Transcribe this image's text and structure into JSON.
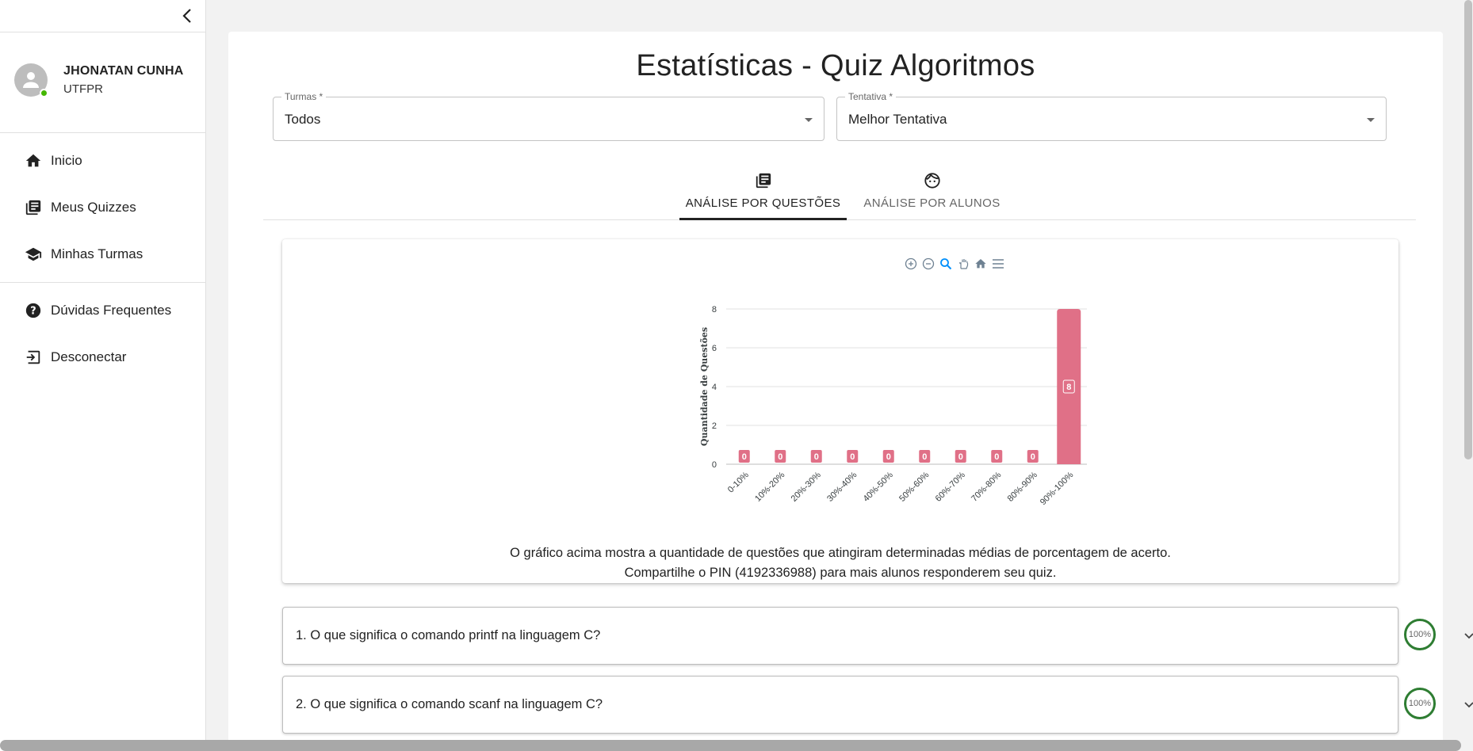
{
  "sidebar": {
    "user": {
      "name": "JHONATAN CUNHA",
      "org": "UTFPR",
      "status_color": "#44b700"
    },
    "nav": [
      {
        "label": "Inicio",
        "icon": "home-icon"
      },
      {
        "label": "Meus Quizzes",
        "icon": "library-books-icon"
      },
      {
        "label": "Minhas Turmas",
        "icon": "school-icon"
      }
    ],
    "nav_secondary": [
      {
        "label": "Dúvidas Frequentes",
        "icon": "help-icon"
      },
      {
        "label": "Desconectar",
        "icon": "logout-icon"
      }
    ]
  },
  "main": {
    "title": "Estatísticas - Quiz Algoritmos",
    "filters": {
      "turmas": {
        "label": "Turmas *",
        "value": "Todos"
      },
      "tentativa": {
        "label": "Tentativa *",
        "value": "Melhor Tentativa"
      }
    },
    "tabs": [
      {
        "label": "ANÁLISE POR QUESTÕES",
        "icon": "library-books-icon",
        "active": true
      },
      {
        "label": "ANÁLISE POR ALUNOS",
        "icon": "face-icon",
        "active": false
      }
    ],
    "chart_caption_line1": "O gráfico acima mostra a quantidade de questões que atingiram determinadas médias de porcentagem de acerto.",
    "chart_caption_line2": "Compartilhe o PIN (4192336988) para mais alunos responderem seu quiz.",
    "questions": [
      {
        "text": "1. O que significa o comando printf na linguagem C?",
        "percent": "100%"
      },
      {
        "text": "2. O que significa o comando scanf na linguagem C?",
        "percent": "100%"
      }
    ]
  },
  "colors": {
    "bar": "#e07087",
    "percent_ring": "#2e7d32",
    "toolbar_icon": "#6e8192"
  },
  "chart_data": {
    "type": "bar",
    "categories": [
      "0-10%",
      "10%-20%",
      "20%-30%",
      "30%-40%",
      "40%-50%",
      "50%-60%",
      "60%-70%",
      "70%-80%",
      "80%-90%",
      "90%-100%"
    ],
    "values": [
      0,
      0,
      0,
      0,
      0,
      0,
      0,
      0,
      0,
      8
    ],
    "title": "",
    "xlabel": "",
    "ylabel": "Quantidade de Questões",
    "ylim": [
      0,
      8
    ],
    "yticks": [
      0,
      2,
      4,
      6,
      8
    ],
    "grid": true,
    "data_labels": true
  }
}
